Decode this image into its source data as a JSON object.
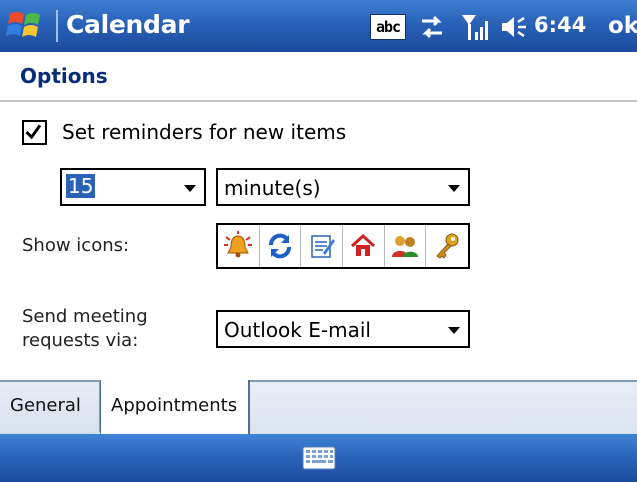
{
  "titlebar": {
    "app_title": "Calendar",
    "status_icons": [
      "abc-input-icon",
      "connectivity-icon",
      "signal-icon",
      "volume-icon"
    ],
    "input_indicator": "abc",
    "clock": "6:44",
    "ok_label": "ok",
    "color": "#2a62b8"
  },
  "header": {
    "title": "Options"
  },
  "reminders": {
    "checked": true,
    "label": "Set reminders for new items",
    "amount": "15",
    "unit": "minute(s)"
  },
  "show_icons": {
    "label": "Show icons:",
    "icons": [
      "alarm-bell-icon",
      "recurrence-icon",
      "note-icon",
      "home-icon",
      "attendees-icon",
      "private-key-icon"
    ]
  },
  "send_meeting": {
    "label_line1": "Send meeting",
    "label_line2": "requests via:",
    "value": "Outlook E-mail"
  },
  "tabs": [
    {
      "label": "General",
      "active": false
    },
    {
      "label": "Appointments",
      "active": true
    }
  ],
  "menubar": {
    "icon": "keyboard-icon"
  }
}
